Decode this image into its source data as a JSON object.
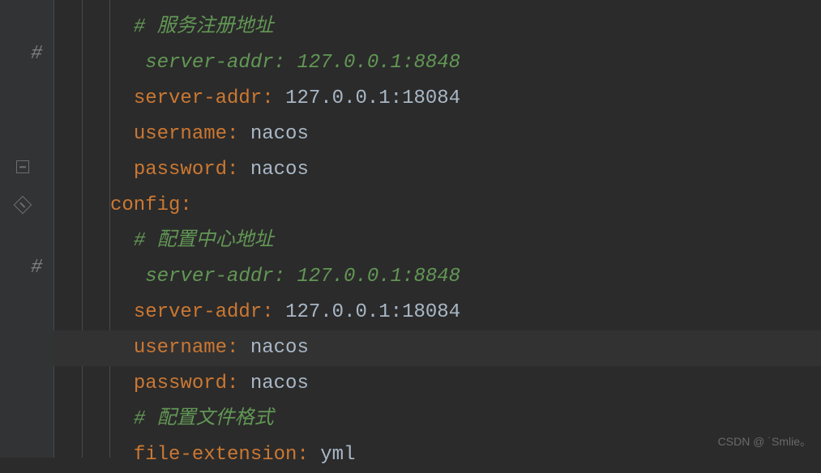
{
  "gutter": {
    "mark1": "#",
    "mark2": "#"
  },
  "code": {
    "line1_comment": "# 服务注册地址",
    "line2_comment": " server-addr: 127.0.0.1:8848",
    "line3_key": "server-addr",
    "line3_value": "127.0.0.1:18084",
    "line4_key": "username",
    "line4_value": "nacos",
    "line5_key": "password",
    "line5_value": "nacos",
    "line6_key": "config",
    "line7_comment": "# 配置中心地址",
    "line8_comment": " server-addr: 127.0.0.1:8848",
    "line9_key": "server-addr",
    "line9_value": "127.0.0.1:18084",
    "line10_key": "username",
    "line10_value": "nacos",
    "line11_key": "password",
    "line11_value": "nacos",
    "line12_comment": "# 配置文件格式",
    "line13_key": "file-extension",
    "line13_value": "yml",
    "colon": ":",
    "colon_space": ": "
  },
  "watermark": "CSDN @ ˙Smlie。"
}
